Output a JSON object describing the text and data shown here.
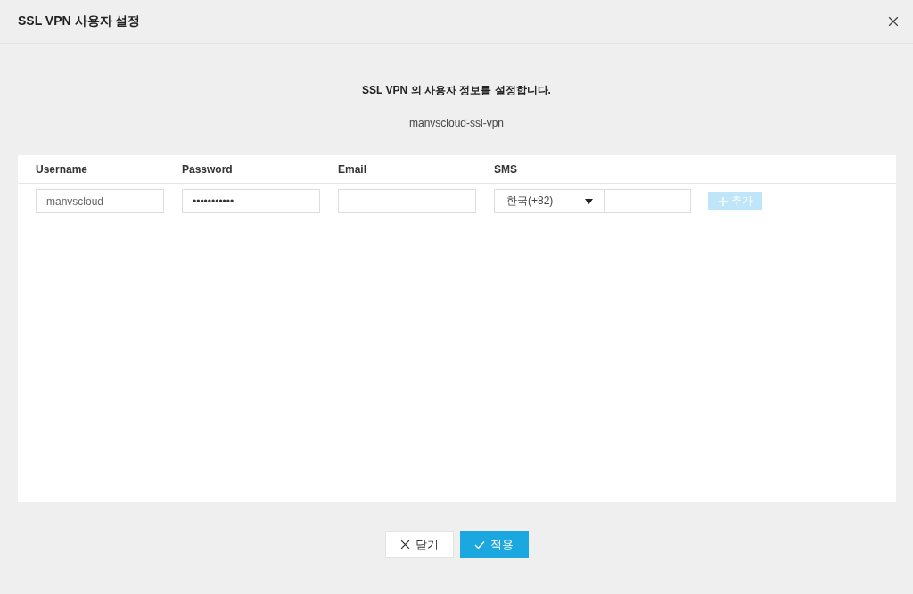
{
  "dialog": {
    "title": "SSL VPN 사용자 설정"
  },
  "intro": {
    "heading": "SSL VPN 의 사용자 정보를 설정합니다.",
    "subtitle": "manvscloud-ssl-vpn"
  },
  "table": {
    "columns": [
      "Username",
      "Password",
      "Email",
      "SMS"
    ],
    "row": {
      "username": "manvscloud",
      "password": "•••••••••••",
      "country": "한국(+82)",
      "add_button": {
        "label": "추가",
        "disabled": true
      }
    }
  },
  "buttons": [
    {
      "label": "닫기",
      "kind": "close"
    },
    {
      "label": "적용",
      "kind": "apply"
    }
  ]
}
